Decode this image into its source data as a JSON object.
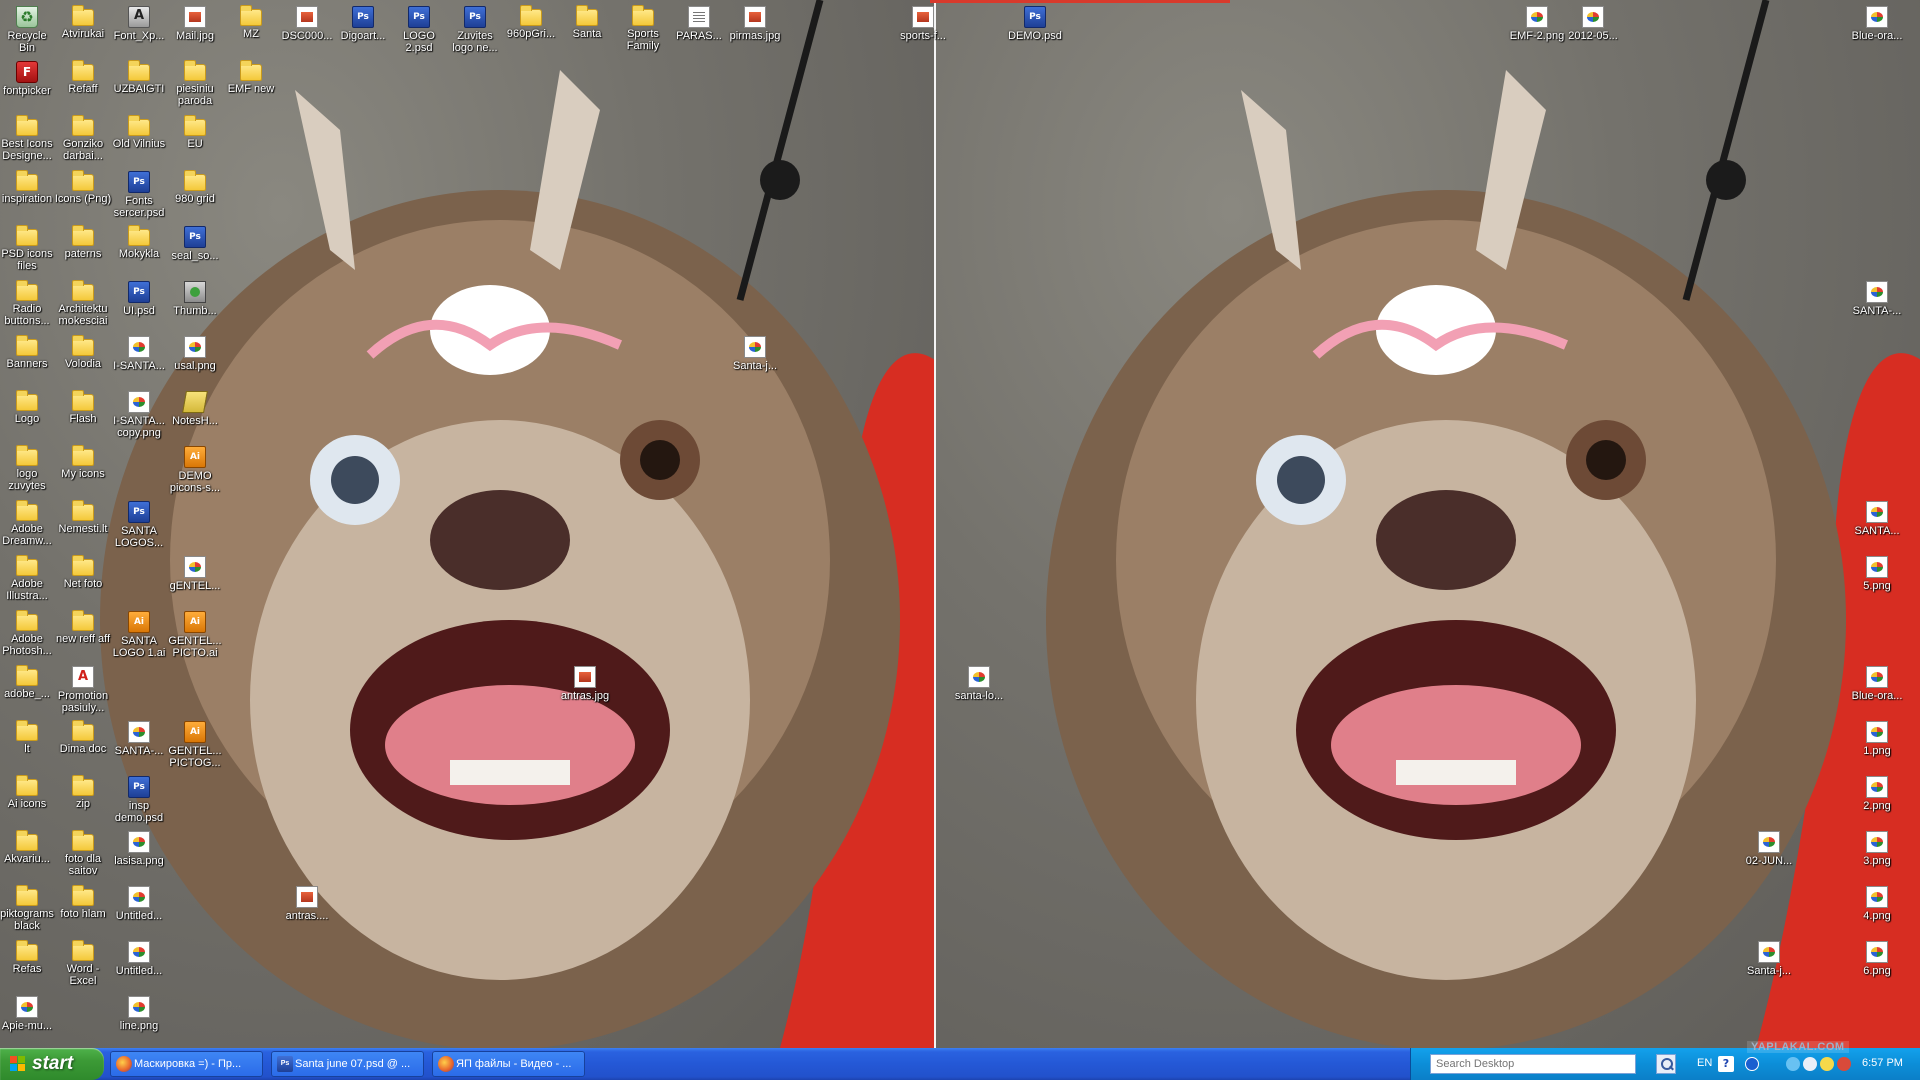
{
  "colors": {
    "taskbar": "#2458d6",
    "start": "#3c9a36",
    "tray": "#0c8ed8",
    "red_bar": "#d83a2c"
  },
  "desktop_icons": [
    {
      "label": "Recycle Bin",
      "type": "bin"
    },
    {
      "label": "Atvirukai",
      "type": "folder"
    },
    {
      "label": "Font_Xp...",
      "type": "app"
    },
    {
      "label": "Mail.jpg",
      "type": "jpg"
    },
    {
      "label": "MZ",
      "type": "folder"
    },
    {
      "label": "DSC000...",
      "type": "jpg"
    },
    {
      "label": "Digoart...",
      "type": "psd"
    },
    {
      "label": "LOGO 2.psd",
      "type": "psd"
    },
    {
      "label": "Zuvites logo ne...",
      "type": "psd"
    },
    {
      "label": "960pGri...",
      "type": "folder"
    },
    {
      "label": "Santa",
      "type": "folder"
    },
    {
      "label": "Sports Family",
      "type": "folder"
    },
    {
      "label": "PARAS...",
      "type": "txt"
    },
    {
      "label": "pirmas.jpg",
      "type": "jpg"
    },
    {
      "label": "sports-f...",
      "type": "jpg"
    },
    {
      "label": "DEMO.psd",
      "type": "psd"
    },
    {
      "label": "EMF-2.png",
      "type": "png"
    },
    {
      "label": "2012-05...",
      "type": "png"
    },
    {
      "label": "Blue-ora...",
      "type": "png"
    },
    {
      "label": "fontpicker",
      "type": "fontpicker"
    },
    {
      "label": "Refaff",
      "type": "folder"
    },
    {
      "label": "UZBAIGTI",
      "type": "folder"
    },
    {
      "label": "piesiniu paroda",
      "type": "folder"
    },
    {
      "label": "EMF new",
      "type": "folder"
    },
    {
      "label": "Best Icons Designe...",
      "type": "folder"
    },
    {
      "label": "Gonziko darbai...",
      "type": "folder"
    },
    {
      "label": "Old Vilnius",
      "type": "folder"
    },
    {
      "label": "EU",
      "type": "folder"
    },
    {
      "label": "inspiration",
      "type": "folder"
    },
    {
      "label": "Icons (Png)",
      "type": "folder"
    },
    {
      "label": "Fonts sercer.psd",
      "type": "psd"
    },
    {
      "label": "980 grid",
      "type": "folder"
    },
    {
      "label": "PSD icons files",
      "type": "folder"
    },
    {
      "label": "paterns",
      "type": "folder"
    },
    {
      "label": "Mokykla",
      "type": "folder"
    },
    {
      "label": "seal_so...",
      "type": "psd"
    },
    {
      "label": "Radio buttons...",
      "type": "folder"
    },
    {
      "label": "Architektu mokesciai",
      "type": "folder"
    },
    {
      "label": "UI.psd",
      "type": "psd"
    },
    {
      "label": "Thumb...",
      "type": "thumb"
    },
    {
      "label": "SANTA-...",
      "type": "png"
    },
    {
      "label": "Banners",
      "type": "folder"
    },
    {
      "label": "Volodia",
      "type": "folder"
    },
    {
      "label": "I-SANTA...",
      "type": "png"
    },
    {
      "label": "usal.png",
      "type": "png"
    },
    {
      "label": "Santa-j...",
      "type": "png"
    },
    {
      "label": "Logo",
      "type": "folder"
    },
    {
      "label": "Flash",
      "type": "folder"
    },
    {
      "label": "I-SANTA... copy.png",
      "type": "png"
    },
    {
      "label": "NotesH...",
      "type": "notes"
    },
    {
      "label": "logo zuvytes",
      "type": "folder"
    },
    {
      "label": "My icons",
      "type": "folder"
    },
    {
      "label": "DEMO picons-s...",
      "type": "ai"
    },
    {
      "label": "SANTA...",
      "type": "png"
    },
    {
      "label": "Adobe Dreamw...",
      "type": "folder"
    },
    {
      "label": "Nemesti.lt",
      "type": "folder"
    },
    {
      "label": "SANTA LOGOS...",
      "type": "psd"
    },
    {
      "label": "5.png",
      "type": "png"
    },
    {
      "label": "Adobe Illustra...",
      "type": "folder"
    },
    {
      "label": "Net foto",
      "type": "folder"
    },
    {
      "label": "gENTEL...",
      "type": "png"
    },
    {
      "label": "Adobe Photosh...",
      "type": "folder"
    },
    {
      "label": "new reff aff",
      "type": "folder"
    },
    {
      "label": "SANTA LOGO 1.ai",
      "type": "ai"
    },
    {
      "label": "GENTEL... PICTO.ai",
      "type": "ai"
    },
    {
      "label": "adobe_...",
      "type": "folder"
    },
    {
      "label": "Promotion pasiuly...",
      "type": "pdf"
    },
    {
      "label": "antras.jpg",
      "type": "jpg"
    },
    {
      "label": "santa-lo...",
      "type": "png"
    },
    {
      "label": "Blue-ora...",
      "type": "png"
    },
    {
      "label": "lt",
      "type": "folder"
    },
    {
      "label": "Dima doc",
      "type": "folder"
    },
    {
      "label": "SANTA-...",
      "type": "png"
    },
    {
      "label": "GENTEL... PICTOG...",
      "type": "ai"
    },
    {
      "label": "1.png",
      "type": "png"
    },
    {
      "label": "Ai icons",
      "type": "folder"
    },
    {
      "label": "zip",
      "type": "folder"
    },
    {
      "label": "insp demo.psd",
      "type": "psd"
    },
    {
      "label": "2.png",
      "type": "png"
    },
    {
      "label": "Akvariu...",
      "type": "folder"
    },
    {
      "label": "foto dla saitov",
      "type": "folder"
    },
    {
      "label": "lasisa.png",
      "type": "png"
    },
    {
      "label": "02-JUN...",
      "type": "png"
    },
    {
      "label": "3.png",
      "type": "png"
    },
    {
      "label": "piktograms black",
      "type": "folder"
    },
    {
      "label": "foto hlam",
      "type": "folder"
    },
    {
      "label": "Untitled...",
      "type": "png"
    },
    {
      "label": "antras....",
      "type": "jpg"
    },
    {
      "label": "4.png",
      "type": "png"
    },
    {
      "label": "Refas",
      "type": "folder"
    },
    {
      "label": "Word - Excel",
      "type": "folder"
    },
    {
      "label": "Untitled...",
      "type": "png"
    },
    {
      "label": "Santa-j...",
      "type": "png"
    },
    {
      "label": "6.png",
      "type": "png"
    },
    {
      "label": "Apie-mu...",
      "type": "png"
    },
    {
      "label": "line.png",
      "type": "png"
    }
  ],
  "taskbar": {
    "start_label": "start",
    "items": [
      {
        "label": "Маскировка =) - Пр...",
        "icon": "firefox-icon"
      },
      {
        "label": "Santa june 07.psd @ ...",
        "icon": "photoshop-icon"
      },
      {
        "label": "ЯП файлы - Видео - ...",
        "icon": "firefox-icon"
      }
    ],
    "search_placeholder": "Search Desktop",
    "language": "EN",
    "clock": "6:57 PM",
    "watermark": "YAPLAKAL.COM"
  }
}
